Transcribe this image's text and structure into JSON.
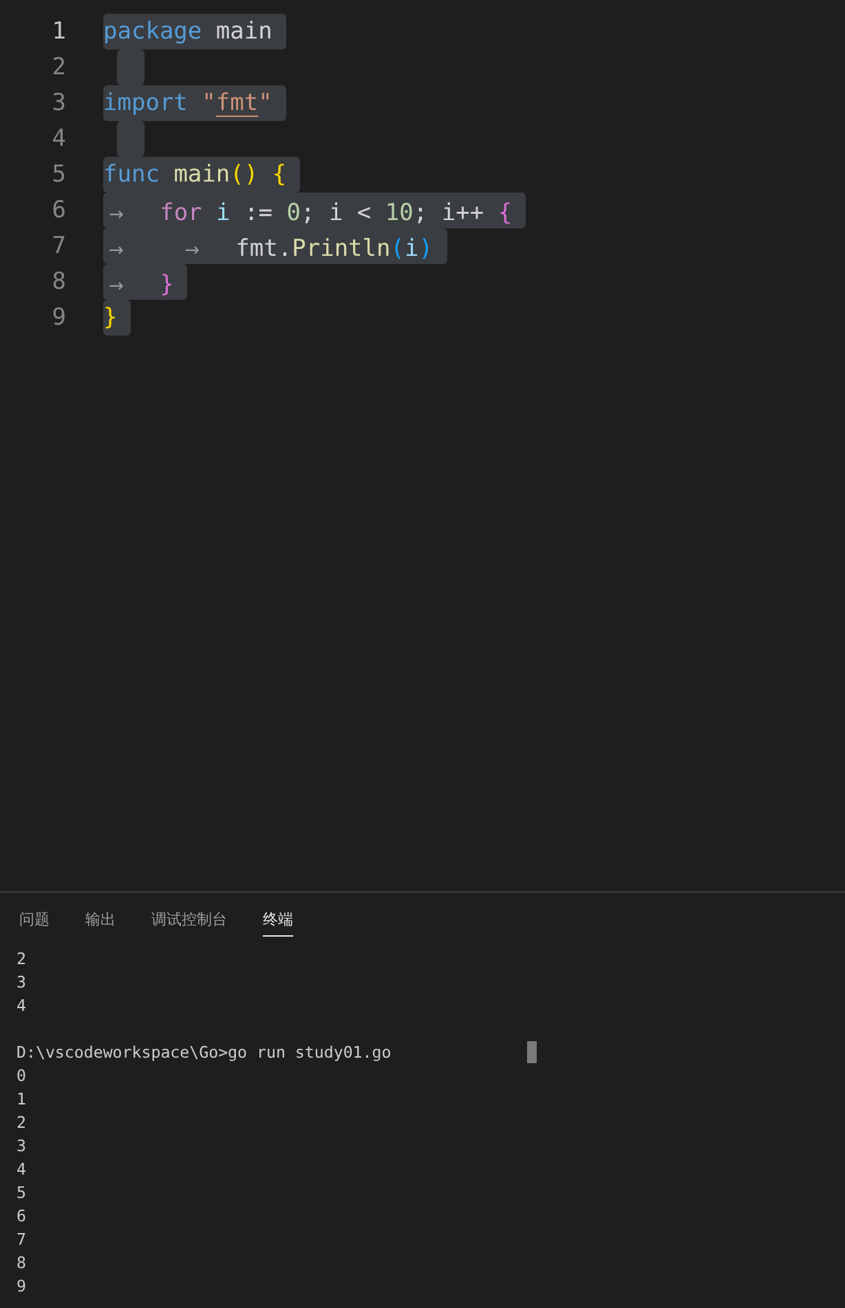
{
  "editor": {
    "selected": true,
    "lines": [
      {
        "number": "1",
        "current": true,
        "tokens": [
          {
            "t": "package",
            "kind": "keyword"
          },
          {
            "t": " main",
            "kind": "plain"
          }
        ]
      },
      {
        "number": "2",
        "current": false
      },
      {
        "number": "3",
        "current": false,
        "tokens": [
          {
            "t": "import",
            "kind": "keyword"
          },
          {
            "t": " \"",
            "kind": "string"
          },
          {
            "t": "fmt",
            "kind": "link"
          },
          {
            "t": "\"",
            "kind": "string"
          }
        ]
      },
      {
        "number": "4",
        "current": false
      },
      {
        "number": "5",
        "current": false,
        "tokens": [
          {
            "t": "func",
            "kind": "keyword"
          },
          {
            "t": " main",
            "kind": "func"
          },
          {
            "t": "()",
            "kind": "bracket1"
          },
          {
            "t": " {",
            "kind": "bracket1"
          }
        ]
      },
      {
        "number": "6",
        "current": false,
        "tokens": [
          {
            "t": "→",
            "kind": "tab"
          },
          {
            "t": "for",
            "kind": "control"
          },
          {
            "t": " i",
            "kind": "variable"
          },
          {
            "t": " := ",
            "kind": "plain"
          },
          {
            "t": "0",
            "kind": "number"
          },
          {
            "t": "; i < ",
            "kind": "plain"
          },
          {
            "t": "10",
            "kind": "number"
          },
          {
            "t": "; i++ ",
            "kind": "plain"
          },
          {
            "t": "{",
            "kind": "bracket2"
          }
        ]
      },
      {
        "number": "7",
        "current": false,
        "tokens": [
          {
            "t": "→",
            "kind": "tab"
          },
          {
            "t": "→",
            "kind": "tab"
          },
          {
            "t": "fmt.",
            "kind": "plain"
          },
          {
            "t": "Println",
            "kind": "func"
          },
          {
            "t": "(",
            "kind": "bracket3"
          },
          {
            "t": "i",
            "kind": "variable"
          },
          {
            "t": ")",
            "kind": "bracket3"
          }
        ]
      },
      {
        "number": "8",
        "current": false,
        "tokens": [
          {
            "t": "→",
            "kind": "tab"
          },
          {
            "t": "}",
            "kind": "bracket2"
          }
        ]
      },
      {
        "number": "9",
        "current": false,
        "tokens": [
          {
            "t": "}",
            "kind": "bracket1"
          }
        ]
      }
    ]
  },
  "panel": {
    "tabs": [
      {
        "label": "问题",
        "selected": false
      },
      {
        "label": "输出",
        "selected": false
      },
      {
        "label": "调试控制台",
        "selected": false
      },
      {
        "label": "终端",
        "selected": true
      }
    ],
    "terminal": [
      {
        "lines": [
          "2",
          "3",
          "4"
        ]
      },
      {
        "lines": [
          "D:\\vscodeworkspace\\Go>go run study01.go",
          "0",
          "1",
          "2",
          "3",
          "4",
          "5",
          "6",
          "7",
          "8",
          "9"
        ]
      }
    ]
  }
}
